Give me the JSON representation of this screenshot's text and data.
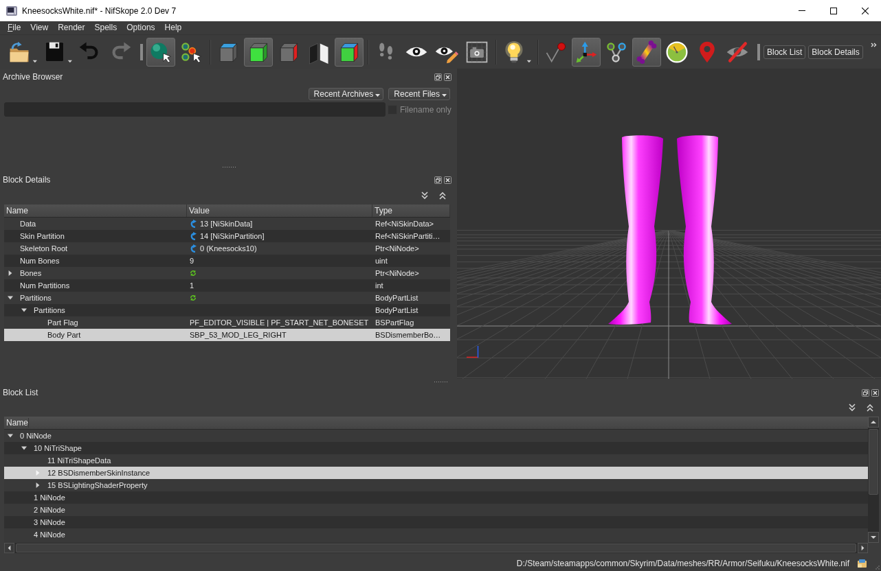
{
  "window": {
    "title": "KneesocksWhite.nif* - NifSkope 2.0 Dev 7"
  },
  "menu": [
    {
      "label": "File",
      "mnemonic": true
    },
    {
      "label": "View",
      "mnemonic": false
    },
    {
      "label": "Render",
      "mnemonic": false
    },
    {
      "label": "Spells",
      "mnemonic": false
    },
    {
      "label": "Options",
      "mnemonic": false
    },
    {
      "label": "Help",
      "mnemonic": false
    }
  ],
  "toolbar": {
    "groups": [
      [
        {
          "checked": false,
          "disabled": false
        },
        {
          "checked": false,
          "disabled": false
        },
        {
          "checked": false,
          "disabled": false
        },
        {
          "checked": false,
          "disabled": true
        }
      ],
      [
        {
          "checked": true,
          "disabled": false
        },
        {
          "checked": false,
          "disabled": false
        }
      ],
      [
        {
          "checked": false,
          "disabled": false
        },
        {
          "checked": true,
          "disabled": false
        },
        {
          "checked": false,
          "disabled": false
        },
        {
          "checked": false,
          "disabled": false
        },
        {
          "checked": true,
          "disabled": false
        }
      ],
      [
        {
          "checked": false,
          "disabled": false
        },
        {
          "checked": false,
          "disabled": false
        },
        {
          "checked": false,
          "disabled": false
        },
        {
          "checked": false,
          "disabled": false
        }
      ],
      [
        {
          "checked": false,
          "disabled": false
        }
      ],
      [
        {
          "checked": false,
          "disabled": false
        },
        {
          "checked": true,
          "disabled": false
        },
        {
          "checked": false,
          "disabled": false
        },
        {
          "checked": true,
          "disabled": false
        },
        {
          "checked": false,
          "disabled": false
        },
        {
          "checked": false,
          "disabled": false
        },
        {
          "checked": false,
          "disabled": false
        }
      ]
    ],
    "panel_buttons": [
      {
        "label": "Block List"
      },
      {
        "label": "Block Details"
      }
    ]
  },
  "archive_browser": {
    "title": "Archive Browser",
    "buttons": [
      {
        "label": "Recent Archives"
      },
      {
        "label": "Recent Files"
      }
    ],
    "filename_only": {
      "label": "Filename only",
      "checked": false,
      "disabled": true
    }
  },
  "block_details": {
    "title": "Block Details",
    "columns": [
      "Name",
      "Value",
      "Type"
    ],
    "rows": [
      {
        "name": "Data",
        "value": "13 [NiSkinData]",
        "type": "Ref<NiSkinData>",
        "kind": "ref",
        "selected": false
      },
      {
        "name": "Skin Partition",
        "value": "14 [NiSkinPartition]",
        "type": "Ref<NiSkinPartiti…",
        "kind": "ref",
        "selected": false
      },
      {
        "name": "Skeleton Root",
        "value": "0 (Kneesocks10)",
        "type": "Ptr<NiNode>",
        "kind": "ref",
        "selected": false
      },
      {
        "name": "Num Bones",
        "value": "9",
        "type": "uint",
        "selected": false
      },
      {
        "name": "Bones",
        "type": "Ptr<NiNode>",
        "kind": "array",
        "expanded": false,
        "selected": false
      },
      {
        "name": "Num Partitions",
        "value": "1",
        "type": "int",
        "selected": false
      },
      {
        "name": "Partitions",
        "type": "BodyPartList",
        "kind": "array",
        "expanded": true,
        "selected": false,
        "children": [
          {
            "name": "Partitions",
            "type": "BodyPartList",
            "expanded": true,
            "selected": false,
            "children": [
              {
                "name": "Part Flag",
                "value": "PF_EDITOR_VISIBLE | PF_START_NET_BONESET",
                "type": "BSPartFlag",
                "selected": false
              },
              {
                "name": "Body Part",
                "value": "SBP_53_MOD_LEG_RIGHT",
                "type": "BSDismemberBo…",
                "selected": true
              }
            ]
          }
        ]
      }
    ]
  },
  "block_list": {
    "title": "Block List",
    "columns": [
      "Name"
    ],
    "rows": [
      {
        "label": "0 NiNode",
        "expanded": true,
        "selected": false,
        "children": [
          {
            "label": "10 NiTriShape",
            "expanded": true,
            "selected": false,
            "children": [
              {
                "label": "11 NiTriShapeData",
                "selected": false
              },
              {
                "label": "12 BSDismemberSkinInstance",
                "expanded": false,
                "selected": true
              },
              {
                "label": "15 BSLightingShaderProperty",
                "expanded": false,
                "selected": false
              }
            ]
          },
          {
            "label": "1 NiNode",
            "selected": false
          },
          {
            "label": "2 NiNode",
            "selected": false
          },
          {
            "label": "3 NiNode",
            "selected": false
          },
          {
            "label": "4 NiNode",
            "selected": false
          }
        ]
      }
    ]
  },
  "status_bar": {
    "path": "D:/Steam/steamapps/common/Skyrim/Data/meshes/RR/Armor/Seifuku/KneesocksWhite.nif"
  }
}
